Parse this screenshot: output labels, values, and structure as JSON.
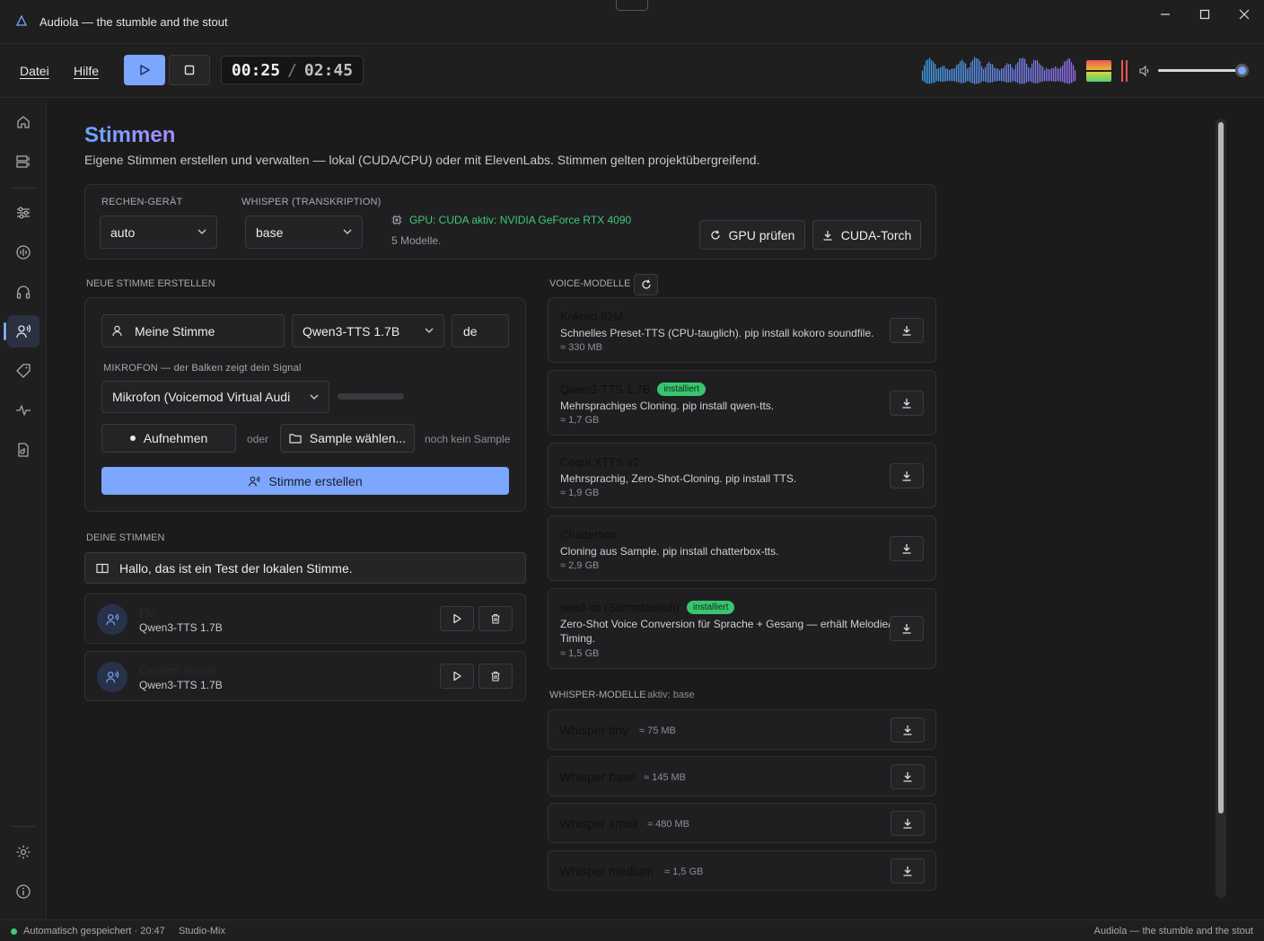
{
  "window": {
    "title": "Audiola — the stumble and the stout"
  },
  "menu": {
    "file": "Datei",
    "help": "Hilfe"
  },
  "transport": {
    "current_time": "00:25",
    "separator": "/",
    "total_time": "02:45",
    "volume_level": 0.98
  },
  "page": {
    "title": "Stimmen",
    "subtitle": "Eigene Stimmen erstellen und verwalten — lokal (CUDA/CPU) oder mit ElevenLabs. Stimmen gelten projektübergreifend."
  },
  "device_panel": {
    "compute_label": "RECHEN-GERÄT",
    "compute_value": "auto",
    "whisper_label": "WHISPER (TRANSKRIPTION)",
    "whisper_value": "base",
    "gpu_status": "GPU: CUDA aktiv: NVIDIA GeForce RTX 4090",
    "models_count": "5 Modelle.",
    "check_gpu_button": "GPU prüfen",
    "cuda_torch_button": "CUDA-Torch"
  },
  "new_voice": {
    "section_label": "NEUE STIMME ERSTELLEN",
    "name_value": "Meine Stimme",
    "model_value": "Qwen3-TTS 1.7B",
    "language_value": "de",
    "mic_label": "MIKROFON — der Balken zeigt dein Signal",
    "mic_value": "Mikrofon (Voicemod Virtual Audi",
    "record_button": "Aufnehmen",
    "or_text": "oder",
    "sample_button": "Sample wählen...",
    "no_sample_text": "noch kein Sample",
    "create_button": "Stimme erstellen"
  },
  "my_voices": {
    "section_label": "DEINE STIMMEN",
    "test_text": "Hallo, das ist ein Test der lokalen Stimme.",
    "items": [
      {
        "name": "Flo",
        "model": "Qwen3-TTS 1.7B"
      },
      {
        "name": "Carsten (local)",
        "model": "Qwen3-TTS 1.7B"
      }
    ]
  },
  "voice_models": {
    "section_label": "VOICE-MODELLE",
    "items": [
      {
        "name": "Kokoro 82M",
        "badge": "",
        "description": "Schnelles Preset-TTS (CPU-tauglich). pip install kokoro soundfile.",
        "size": "≈ 330 MB"
      },
      {
        "name": "Qwen3-TTS 1.7B",
        "badge": "installiert",
        "description": "Mehrsprachiges Cloning. pip install qwen-tts.",
        "size": "≈ 1,7 GB"
      },
      {
        "name": "Coqui XTTS v2",
        "badge": "",
        "description": "Mehrsprachig, Zero-Shot-Cloning. pip install TTS.",
        "size": "≈ 1,9 GB"
      },
      {
        "name": "Chatterbox",
        "badge": "",
        "description": "Cloning aus Sample. pip install chatterbox-tts.",
        "size": "≈ 2,9 GB"
      },
      {
        "name": "seed-vc (Stimmtausch)",
        "badge": "installiert",
        "description": "Zero-Shot Voice Conversion für Sprache + Gesang — erhält Melodie/ Timing.",
        "size": "≈ 1,5 GB"
      }
    ]
  },
  "whisper_models": {
    "section_label": "WHISPER-MODELLE",
    "active_text": "aktiv: base",
    "items": [
      {
        "name": "Whisper tiny",
        "size": "≈ 75 MB"
      },
      {
        "name": "Whisper base",
        "size": "≈ 145 MB"
      },
      {
        "name": "Whisper small",
        "size": "≈ 480 MB"
      },
      {
        "name": "Whisper medium",
        "size": "≈ 1,5 GB"
      }
    ]
  },
  "statusbar": {
    "saved": "Automatisch gespeichert · 20:47",
    "mix": "Studio-Mix",
    "right": "Audiola — the stumble and the stout"
  },
  "colors": {
    "accent": "#7da6ff",
    "success": "#3ec97a",
    "background": "#1b1b1c"
  },
  "icons": {
    "sidebar": [
      "home-icon",
      "layers-icon",
      "sliders-icon",
      "audio-icon",
      "headphones-icon",
      "voice-icon",
      "tag-icon",
      "pulse-icon",
      "file-audio-icon",
      "settings-icon",
      "info-icon"
    ]
  }
}
